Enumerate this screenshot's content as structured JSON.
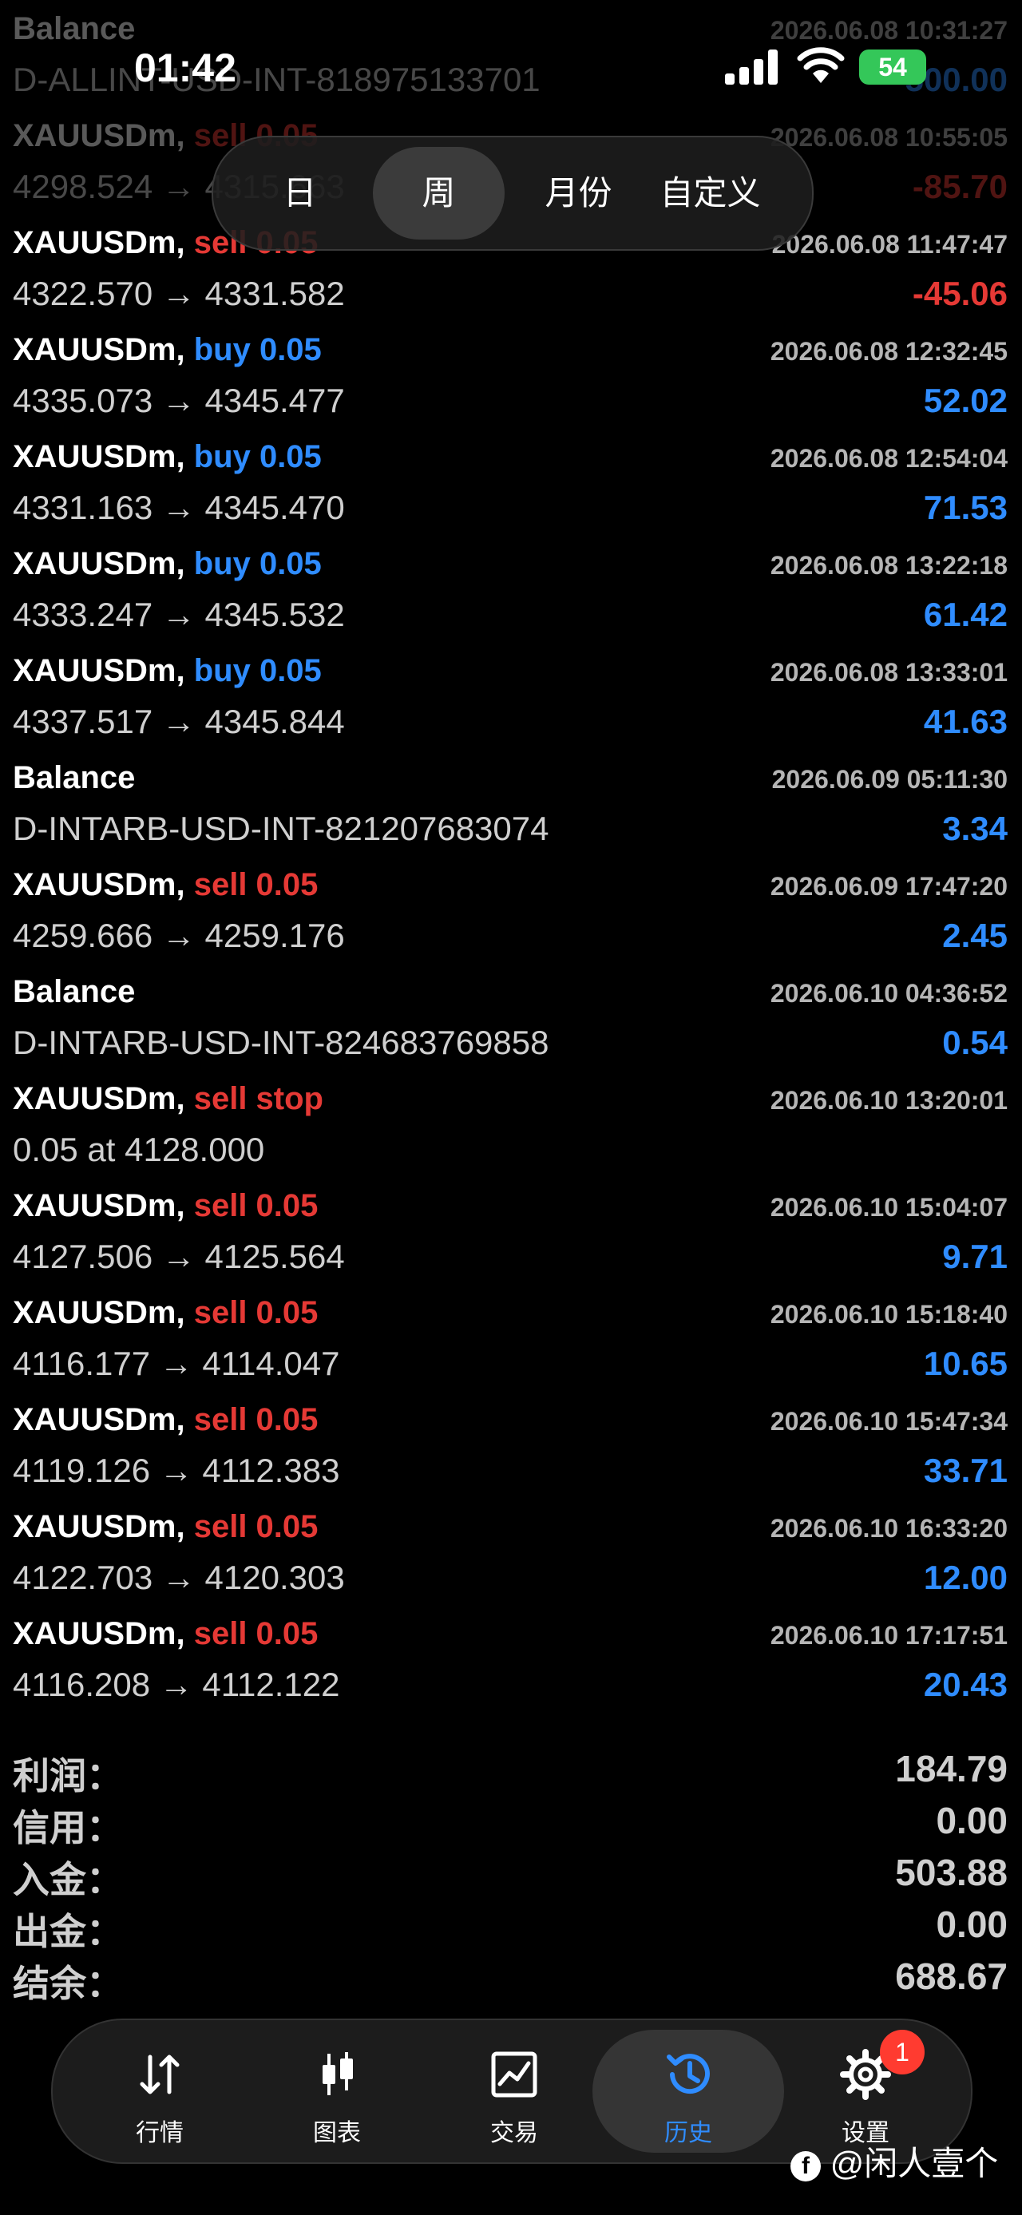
{
  "status": {
    "time": "01:42",
    "battery": "54"
  },
  "segments": [
    "日",
    "周",
    "月份",
    "自定义"
  ],
  "segment_active": "周",
  "rows": [
    {
      "sym": "Balance",
      "side": "",
      "side_type": "",
      "time": "2026.06.08 10:31:27",
      "detail": "D-ALLINT-USD-INT-818975133701",
      "profit": "500.00",
      "profit_type": "pos"
    },
    {
      "sym": "XAUUSDm,",
      "side": "sell 0.05",
      "side_type": "sell",
      "time": "2026.06.08 10:55:05",
      "detail": "4298.524 → 4315.663",
      "profit": "-85.70",
      "profit_type": "neg"
    },
    {
      "sym": "XAUUSDm,",
      "side": "sell 0.05",
      "side_type": "sell",
      "time": "2026.06.08 11:47:47",
      "detail": "4322.570 → 4331.582",
      "profit": "-45.06",
      "profit_type": "neg"
    },
    {
      "sym": "XAUUSDm,",
      "side": "buy 0.05",
      "side_type": "buy",
      "time": "2026.06.08 12:32:45",
      "detail": "4335.073 → 4345.477",
      "profit": "52.02",
      "profit_type": "pos"
    },
    {
      "sym": "XAUUSDm,",
      "side": "buy 0.05",
      "side_type": "buy",
      "time": "2026.06.08 12:54:04",
      "detail": "4331.163 → 4345.470",
      "profit": "71.53",
      "profit_type": "pos"
    },
    {
      "sym": "XAUUSDm,",
      "side": "buy 0.05",
      "side_type": "buy",
      "time": "2026.06.08 13:22:18",
      "detail": "4333.247 → 4345.532",
      "profit": "61.42",
      "profit_type": "pos"
    },
    {
      "sym": "XAUUSDm,",
      "side": "buy 0.05",
      "side_type": "buy",
      "time": "2026.06.08 13:33:01",
      "detail": "4337.517 → 4345.844",
      "profit": "41.63",
      "profit_type": "pos"
    },
    {
      "sym": "Balance",
      "side": "",
      "side_type": "",
      "time": "2026.06.09 05:11:30",
      "detail": "D-INTARB-USD-INT-821207683074",
      "profit": "3.34",
      "profit_type": "pos"
    },
    {
      "sym": "XAUUSDm,",
      "side": "sell 0.05",
      "side_type": "sell",
      "time": "2026.06.09 17:47:20",
      "detail": "4259.666 → 4259.176",
      "profit": "2.45",
      "profit_type": "pos"
    },
    {
      "sym": "Balance",
      "side": "",
      "side_type": "",
      "time": "2026.06.10 04:36:52",
      "detail": "D-INTARB-USD-INT-824683769858",
      "profit": "0.54",
      "profit_type": "pos"
    },
    {
      "sym": "XAUUSDm,",
      "side": "sell stop",
      "side_type": "sell",
      "time": "2026.06.10 13:20:01",
      "detail": "0.05 at 4128.000",
      "profit": "",
      "profit_type": ""
    },
    {
      "sym": "XAUUSDm,",
      "side": "sell 0.05",
      "side_type": "sell",
      "time": "2026.06.10 15:04:07",
      "detail": "4127.506 → 4125.564",
      "profit": "9.71",
      "profit_type": "pos"
    },
    {
      "sym": "XAUUSDm,",
      "side": "sell 0.05",
      "side_type": "sell",
      "time": "2026.06.10 15:18:40",
      "detail": "4116.177 → 4114.047",
      "profit": "10.65",
      "profit_type": "pos"
    },
    {
      "sym": "XAUUSDm,",
      "side": "sell 0.05",
      "side_type": "sell",
      "time": "2026.06.10 15:47:34",
      "detail": "4119.126 → 4112.383",
      "profit": "33.71",
      "profit_type": "pos"
    },
    {
      "sym": "XAUUSDm,",
      "side": "sell 0.05",
      "side_type": "sell",
      "time": "2026.06.10 16:33:20",
      "detail": "4122.703 → 4120.303",
      "profit": "12.00",
      "profit_type": "pos"
    },
    {
      "sym": "XAUUSDm,",
      "side": "sell 0.05",
      "side_type": "sell",
      "time": "2026.06.10 17:17:51",
      "detail": "4116.208 → 4112.122",
      "profit": "20.43",
      "profit_type": "pos"
    }
  ],
  "summary": [
    {
      "label": "利润：",
      "value": "184.79"
    },
    {
      "label": "信用：",
      "value": "0.00"
    },
    {
      "label": "入金：",
      "value": "503.88"
    },
    {
      "label": "出金：",
      "value": "0.00"
    },
    {
      "label": "结余：",
      "value": "688.67"
    }
  ],
  "tabs": [
    {
      "label": "行情",
      "icon": "arrows-updown-icon"
    },
    {
      "label": "图表",
      "icon": "candlestick-icon"
    },
    {
      "label": "交易",
      "icon": "trade-chart-icon"
    },
    {
      "label": "历史",
      "icon": "history-clock-icon"
    },
    {
      "label": "设置",
      "icon": "gear-icon"
    }
  ],
  "tab_active": "历史",
  "settings_badge": "1",
  "watermark": "@闲人壹个",
  "colors": {
    "sell": "#e53935",
    "buy": "#2f8cff",
    "background": "#000000"
  }
}
